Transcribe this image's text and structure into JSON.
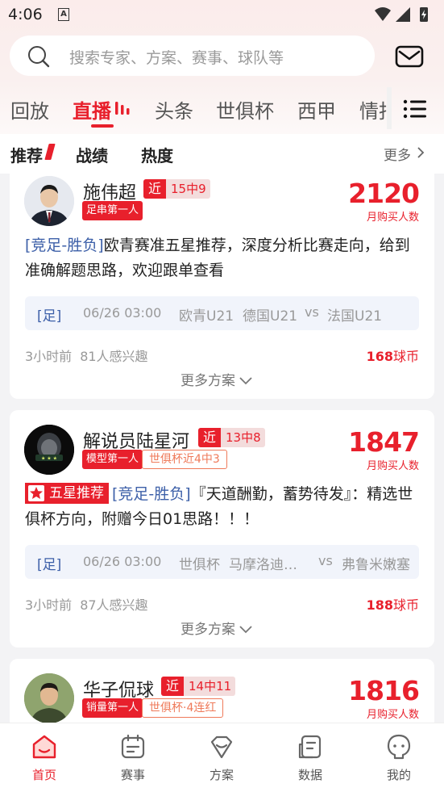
{
  "status_bar": {
    "time": "4:06",
    "a_icon": "A"
  },
  "search": {
    "placeholder": "搜索专家、方案、赛事、球队等"
  },
  "top_tabs": [
    "回放",
    "直播",
    "头条",
    "世俱杯",
    "西甲",
    "情报"
  ],
  "sub_tabs": [
    "推荐",
    "战绩",
    "热度"
  ],
  "more_label": "更多",
  "colors": {
    "accent": "#e8202c",
    "lottery_blue": "#3c5fa8",
    "outline_tag": "#ef7a5a"
  },
  "cards": [
    {
      "name": "施伟超",
      "jin": "近",
      "record": "15中9",
      "tag_red": "足串第一人",
      "tag_outline": "",
      "buyers": "2120",
      "buyers_label": "月购买人数",
      "badge": "",
      "lottery": "[竞足-胜负]",
      "desc": "欧青赛准五星推荐，深度分析比赛走向，给到准确解题思路，欢迎跟单查看",
      "match": {
        "type": "[足]",
        "time": "06/26 03:00",
        "league": "欧青U21",
        "home": "德国U21",
        "vs": "vs",
        "away": "法国U21"
      },
      "time_ago": "3小时前",
      "interest": "81人感兴趣",
      "price": "168",
      "price_unit": "球币",
      "more_plans": "更多方案"
    },
    {
      "name": "解说员陆星河",
      "jin": "近",
      "record": "13中8",
      "tag_red": "模型第一人",
      "tag_outline": "世俱杯近4中3",
      "buyers": "1847",
      "buyers_label": "月购买人数",
      "badge": "五星推荐",
      "lottery": "[竞足-胜负]",
      "desc": "『天道酬勤，蓄势待发』：精选世俱杯方向，附赠今日01思路！！！",
      "match": {
        "type": "[足]",
        "time": "06/26 03:00",
        "league": "世俱杯",
        "home": "马摩洛迪…",
        "vs": "vs",
        "away": "弗鲁米嫩塞"
      },
      "time_ago": "3小时前",
      "interest": "87人感兴趣",
      "price": "188",
      "price_unit": "球币",
      "more_plans": "更多方案"
    },
    {
      "name": "华子侃球",
      "jin": "近",
      "record": "14中11",
      "tag_red": "销量第一人",
      "tag_outline": "世俱杯·4连红",
      "buyers": "1816",
      "buyers_label": "月购买人数"
    }
  ],
  "bottom_nav": [
    {
      "label": "首页",
      "icon": "home-icon"
    },
    {
      "label": "赛事",
      "icon": "calendar-icon"
    },
    {
      "label": "方案",
      "icon": "plan-icon"
    },
    {
      "label": "数据",
      "icon": "data-icon"
    },
    {
      "label": "我的",
      "icon": "profile-icon"
    }
  ]
}
